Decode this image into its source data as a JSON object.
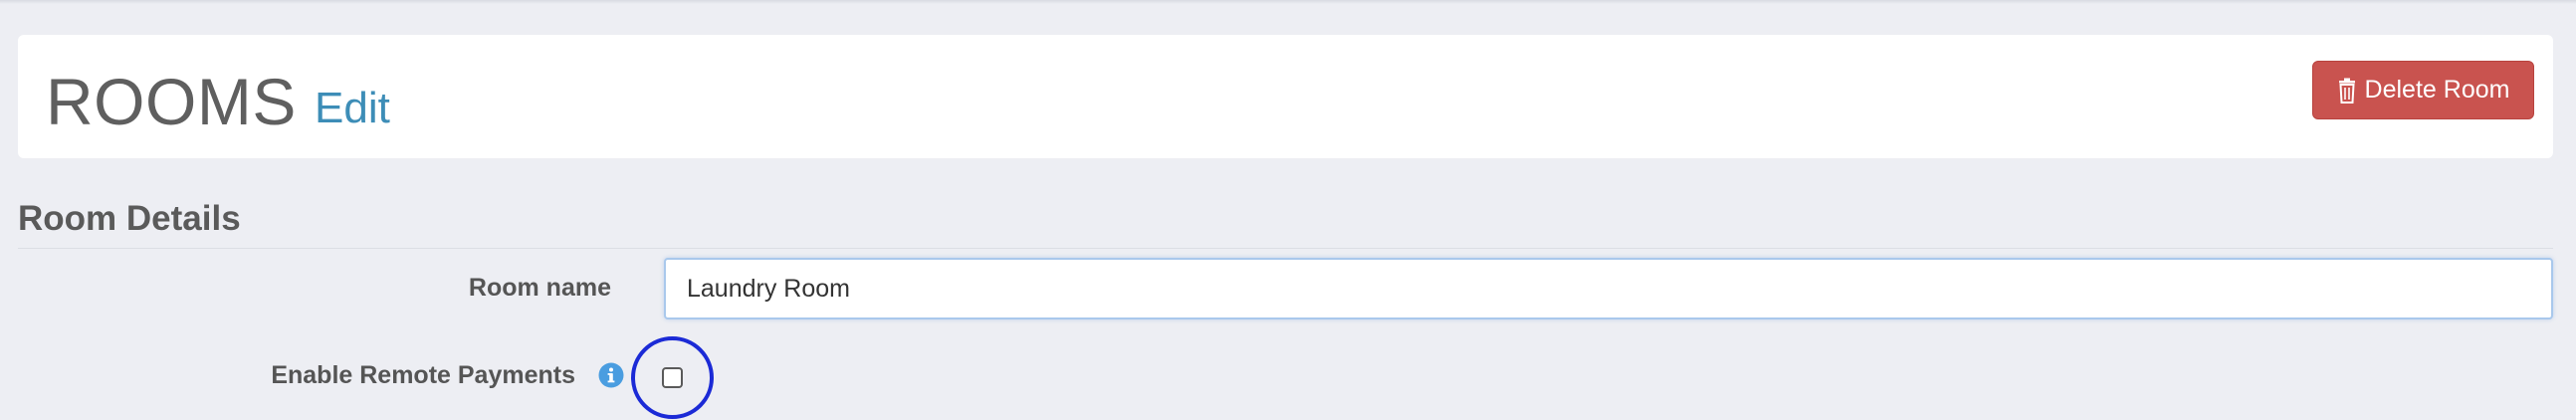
{
  "header": {
    "title": "ROOMS",
    "edit_label": "Edit",
    "delete_label": "Delete Room"
  },
  "section": {
    "title": "Room Details"
  },
  "form": {
    "room_name_label": "Room name",
    "room_name_value": "Laundry Room",
    "remote_payments_label": "Enable Remote Payments",
    "remote_payments_checked": false
  },
  "colors": {
    "accent": "#3d8db7",
    "danger": "#c9534f",
    "highlight": "#1b2ad6",
    "info": "#4a9de0"
  },
  "icons": {
    "delete": "trash-icon",
    "info": "info-icon"
  }
}
